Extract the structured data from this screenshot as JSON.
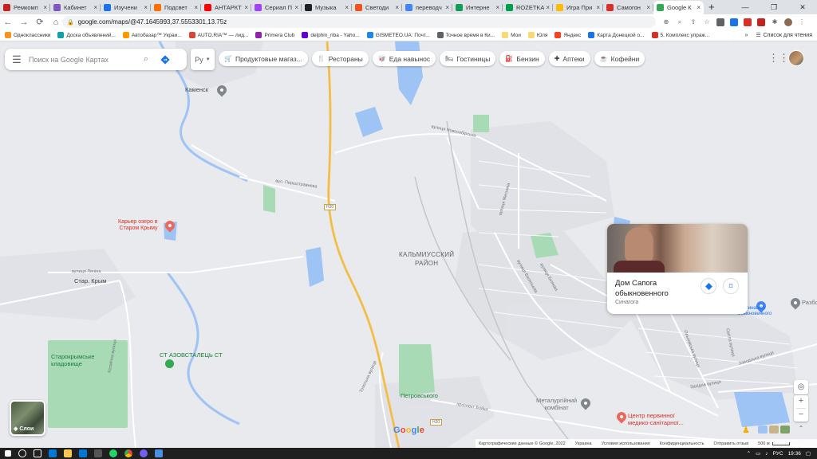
{
  "browser": {
    "tabs": [
      {
        "label": "Ремкомп",
        "color": "#c5221f",
        "active": false
      },
      {
        "label": "Кабинет",
        "color": "#7e57c2",
        "active": false
      },
      {
        "label": "Изучени",
        "color": "#1a73e8",
        "active": false
      },
      {
        "label": "Подсвет",
        "color": "#ff6f00",
        "active": false
      },
      {
        "label": "АНТАРКТ",
        "color": "#ff0000",
        "active": false
      },
      {
        "label": "Сериал П",
        "color": "#a142f4",
        "active": false
      },
      {
        "label": "Музыка",
        "color": "#202124",
        "active": false
      },
      {
        "label": "Светоди",
        "color": "#f4511e",
        "active": false
      },
      {
        "label": "переводч",
        "color": "#4285f4",
        "active": false
      },
      {
        "label": "Интерне",
        "color": "#0f9d58",
        "active": false
      },
      {
        "label": "ROZETKA",
        "color": "#00a046",
        "active": false
      },
      {
        "label": "Игра При",
        "color": "#fbbc04",
        "active": false
      },
      {
        "label": "Самогон",
        "color": "#d93025",
        "active": false
      },
      {
        "label": "Google К",
        "color": "#34a853",
        "active": true
      }
    ],
    "new_tab": "+",
    "url": "google.com/maps/@47.1645993,37.5553301,13.75z",
    "bookmarks": [
      {
        "label": "Одноклассники",
        "color": "#f7931e"
      },
      {
        "label": "Доска объявлений...",
        "color": "#12a0a8"
      },
      {
        "label": "Автобазар™ Украи...",
        "color": "#ff9800"
      },
      {
        "label": "AUTO.RIA™ — лид...",
        "color": "#db4437"
      },
      {
        "label": "Primera Club",
        "color": "#8e24aa"
      },
      {
        "label": "delphin_riba - Yaho...",
        "color": "#6001d2"
      },
      {
        "label": "GISMETEO.UA: Почт...",
        "color": "#1e88e5"
      },
      {
        "label": "Точное время в Ки...",
        "color": "#5f6368"
      },
      {
        "label": "Мои",
        "color": "#f9d976"
      },
      {
        "label": "Юля",
        "color": "#f9d976"
      },
      {
        "label": "Яндекс",
        "color": "#fc3f1d"
      },
      {
        "label": "Карта Донецкой о...",
        "color": "#1a73e8"
      },
      {
        "label": "5. Комплекс упраж...",
        "color": "#d93025"
      }
    ],
    "bookmarks_more": "»",
    "reading_list": "Список для чтения"
  },
  "search": {
    "placeholder": "Поиск на Google Картах",
    "lang": "Ру"
  },
  "chips": [
    {
      "label": "Продуктовые магаз...",
      "icon": "cart-icon",
      "glyph": "🛒"
    },
    {
      "label": "Рестораны",
      "icon": "restaurant-icon",
      "glyph": "🍴"
    },
    {
      "label": "Еда навынос",
      "icon": "takeout-icon",
      "glyph": "🥡"
    },
    {
      "label": "Гостиницы",
      "icon": "hotel-icon",
      "glyph": "🛏"
    },
    {
      "label": "Бензин",
      "icon": "gas-icon",
      "glyph": "⛽"
    },
    {
      "label": "Аптеки",
      "icon": "pharmacy-icon",
      "glyph": "✚"
    },
    {
      "label": "Кофейни",
      "icon": "coffee-icon",
      "glyph": "☕"
    }
  ],
  "map_labels": {
    "kamensk": "Каменск",
    "district": "КАЛЬМИУССКИЙ\nРАЙОН",
    "quarry_lake": "Карьер озеро в\nСтаром Крыму",
    "stary_krym": "Стар. Крым",
    "azovstal": "СТ АЗОВСТАЛЕЦЬ СТ",
    "cemetery": "Старокрымське\nкладовище",
    "petrovsky": "Петровського",
    "metall_plant": "Металургійний\nкомбінат",
    "med_center": "Центр первинної\nмедико-санітарної...",
    "razbo": "Разбо",
    "synagogue_short": "Синагога\nобыкновенного",
    "h20_top": "H20",
    "h20_bottom": "H20",
    "street_novosibirska": "вулиця Новосибірська",
    "street_pershotravneva": "вул. Першотравнева",
    "street_lenina": "вулиця Леніна",
    "street_mesnyka": "вулиця Месника",
    "street_bilyaieva": "вулиця Біляєва",
    "street_vasylieva": "вулиця Васильєва",
    "street_boikova": "проспект Бойка",
    "street_topolna": "Топольна вулиця",
    "street_kosmichna": "Космічна вулиця",
    "street_zavodska": "Заводська вулиця",
    "street_zkhidna": "Західна вулиця",
    "street_olhovska": "Ольховська вулиця",
    "street_svitla": "Світла вулиця"
  },
  "place_card": {
    "title": "Дом Сапога обыкновенного",
    "category": "Синагога"
  },
  "layers_label": "Слои",
  "footer": {
    "map_data": "Картографические данные © Google, 2022",
    "country": "Украина",
    "terms": "Условия использования",
    "privacy": "Конфиденциальность",
    "feedback": "Отправить отзыв",
    "scale": "500 м"
  },
  "taskbar": {
    "lang": "РУС",
    "time": "19:36"
  },
  "colors": {
    "road_major": "#f6c657",
    "water": "#9ec3f5",
    "park": "#a8dab5",
    "map_bg": "#e8eaed"
  }
}
